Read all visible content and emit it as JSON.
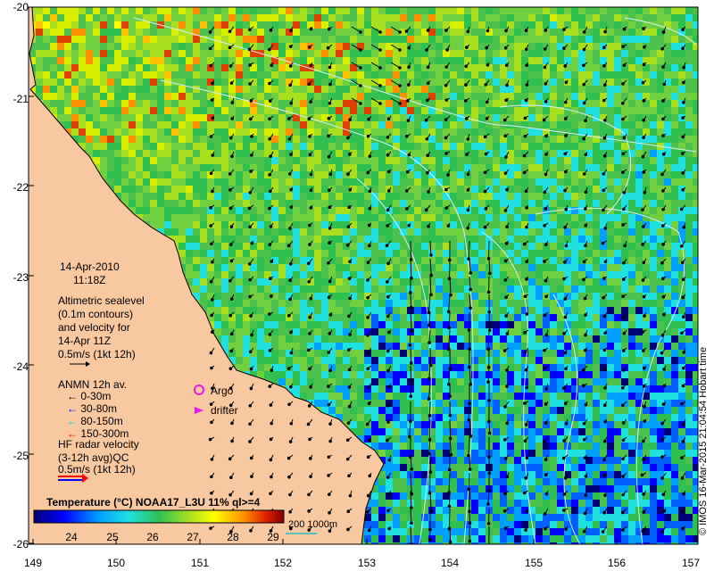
{
  "map": {
    "lat_ticks": [
      "-20",
      "-21",
      "-22",
      "-23",
      "-24",
      "-25",
      "-26"
    ],
    "lon_ticks": [
      "149",
      "150",
      "151",
      "152",
      "153",
      "154",
      "155",
      "156",
      "157"
    ]
  },
  "date_block": {
    "date": "14-Apr-2010",
    "time": "11:18Z"
  },
  "altimetric_block": {
    "lines": [
      "Altimetric sealevel",
      "(0.1m contours)",
      "and velocity for",
      "14-Apr 11Z",
      "0.5m/s (1kt 12h)"
    ]
  },
  "anmn_block": {
    "title": "ANMN 12h av.",
    "items": [
      {
        "label": "0-30m",
        "color": "#000000"
      },
      {
        "label": "30-80m",
        "color": "#0000ff"
      },
      {
        "label": "80-150m",
        "color": "#00c8c8"
      },
      {
        "label": "150-300m",
        "color": "#ff0000"
      }
    ]
  },
  "argo_label": "Argo",
  "drifter_label": "drifter",
  "hf_block": {
    "lines": [
      "HF radar velocity",
      "(3-12h avg)QC",
      "0.5m/s (1kt 12h)"
    ]
  },
  "colorbar": {
    "title": "Temperature (°C) NOAA17_L3U 11% ql>=4",
    "ticks": [
      "24",
      "25",
      "26",
      "27",
      "28",
      "29"
    ]
  },
  "isobath_label": "200  1000m",
  "credit": "© IMOS 16-Mar-2015 21:04:54 Hobart time",
  "colors": {
    "land": "#f8c9a0",
    "contour": "#d8ecff"
  }
}
